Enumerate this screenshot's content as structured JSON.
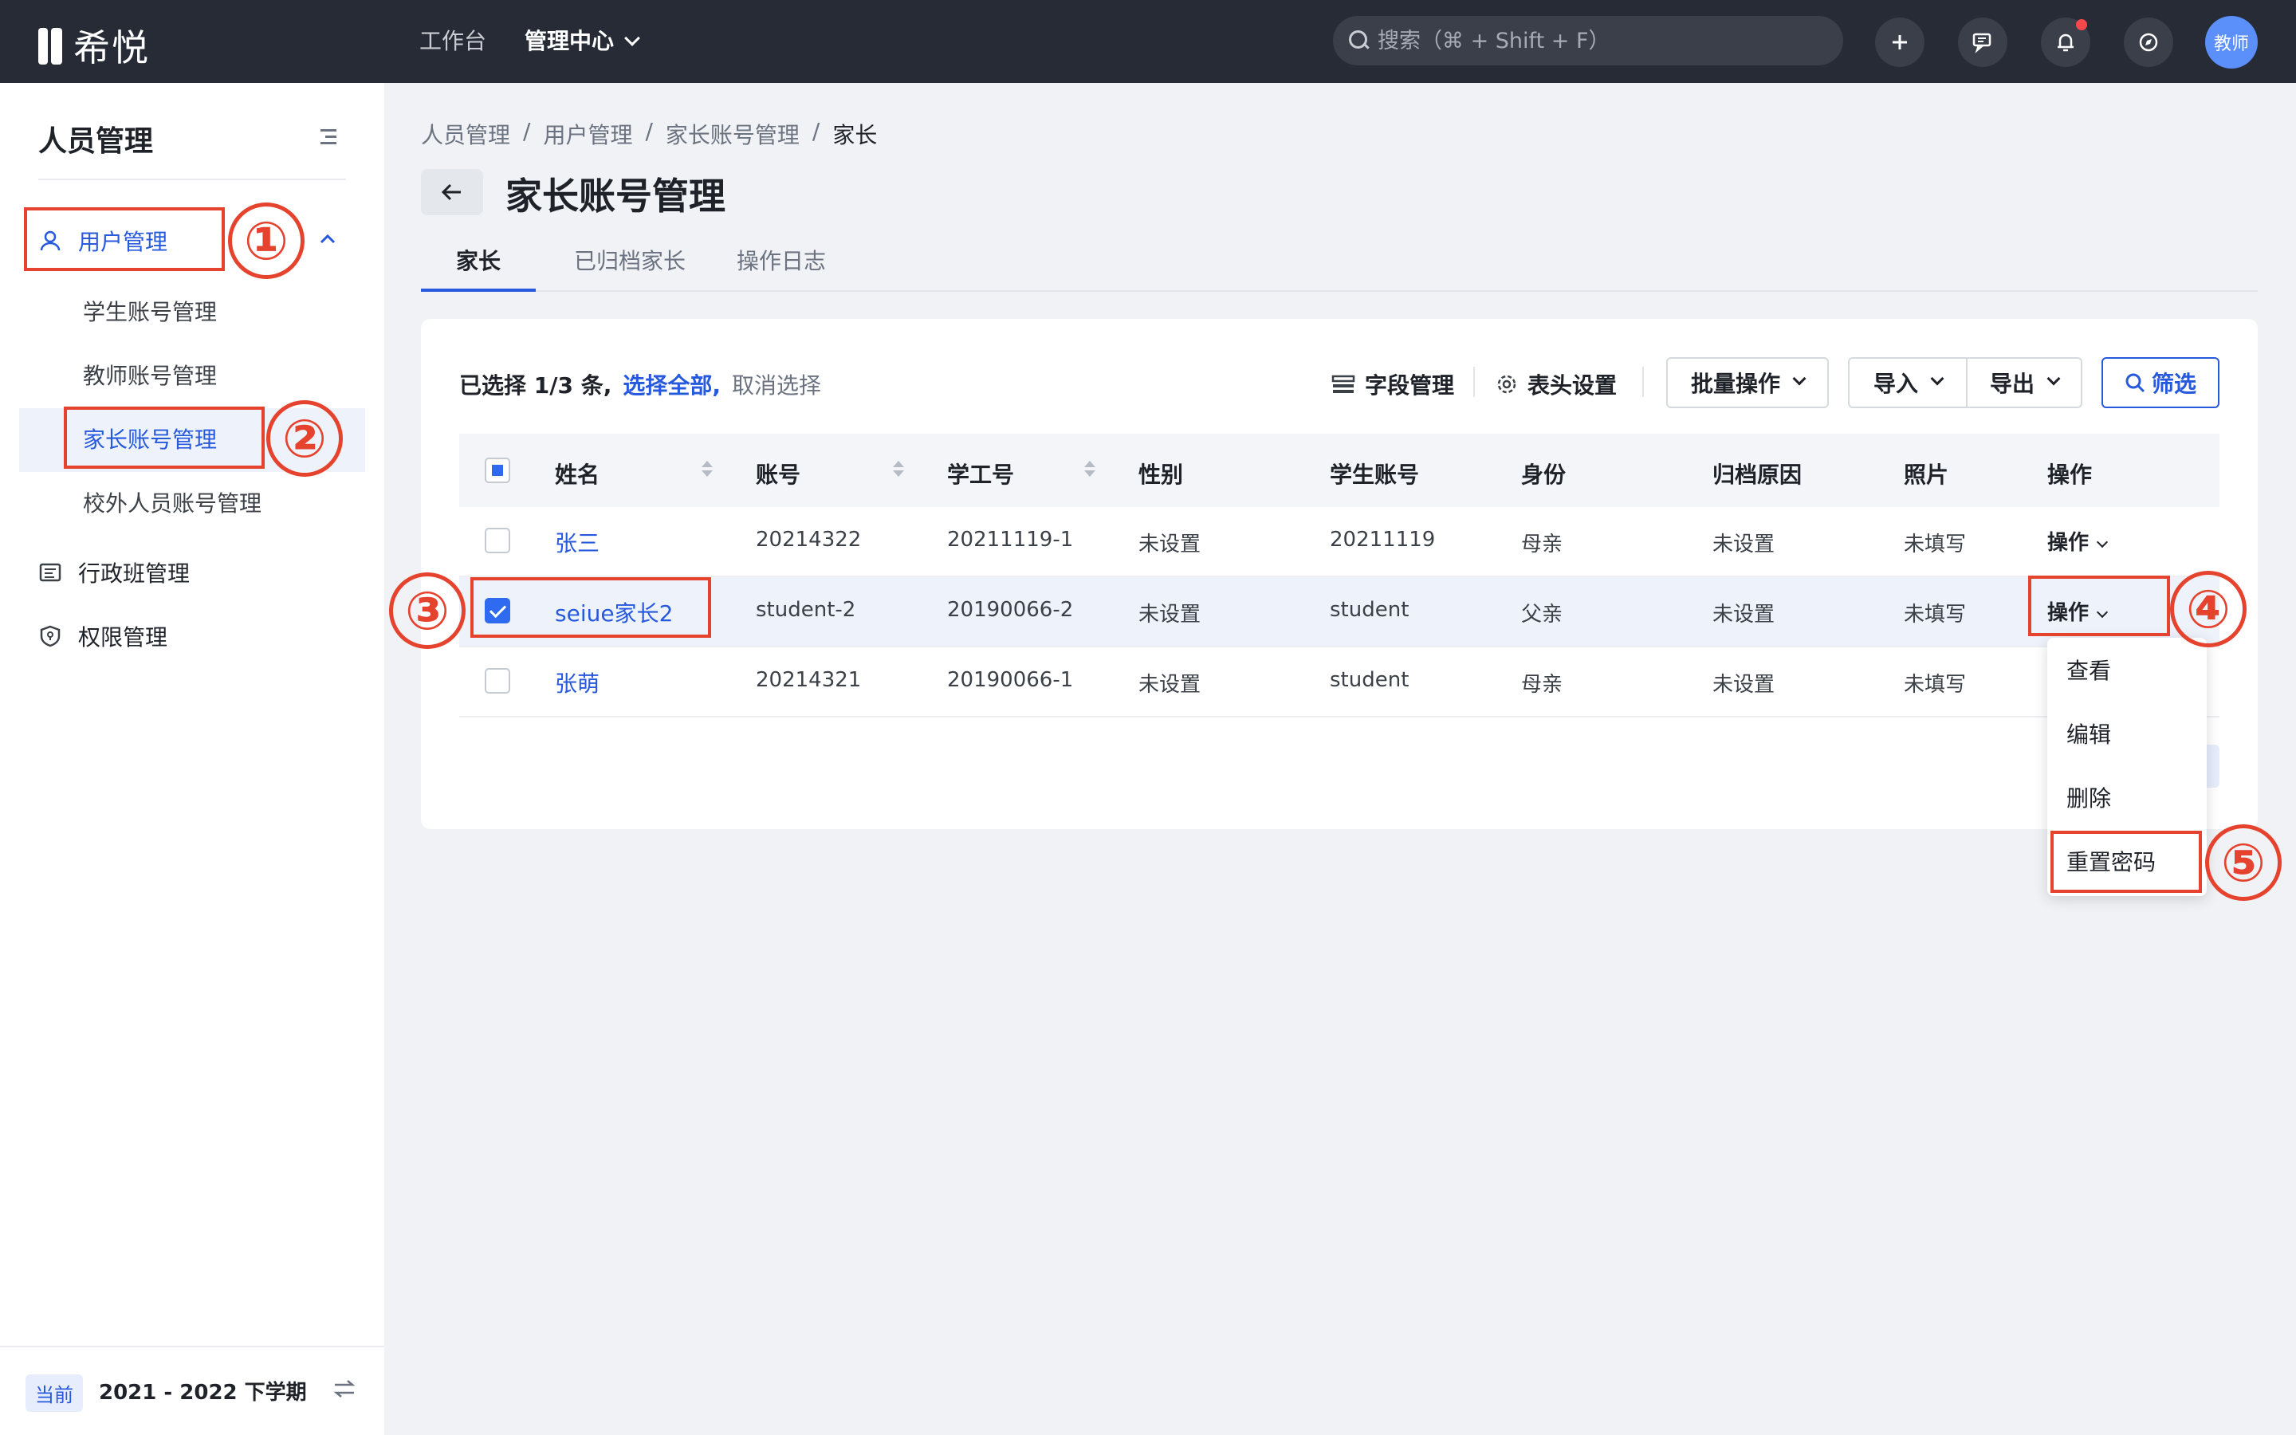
{
  "app": {
    "logo_text": "希悦"
  },
  "topnav": {
    "workbench": "工作台",
    "admin_center": "管理中心"
  },
  "search": {
    "placeholder": "搜索（⌘ + Shift + F）"
  },
  "topbar_icons": [
    "plus-icon",
    "chat-icon",
    "bell-icon",
    "compass-icon"
  ],
  "user": {
    "avatar_label": "教师"
  },
  "sidebar": {
    "title": "人员管理",
    "user_mgmt": "用户管理",
    "sub_items": [
      "学生账号管理",
      "教师账号管理",
      "家长账号管理",
      "校外人员账号管理"
    ],
    "admin_class": "行政班管理",
    "permission": "权限管理",
    "term_badge": "当前",
    "term_text": "2021 - 2022 下学期"
  },
  "breadcrumb": [
    "人员管理",
    "用户管理",
    "家长账号管理",
    "家长"
  ],
  "breadcrumb_sep": "/",
  "page_title": "家长账号管理",
  "tabs": [
    "家长",
    "已归档家长",
    "操作日志"
  ],
  "selection": {
    "selected": "已选择 1/3 条,",
    "select_all": "选择全部,",
    "cancel": "取消选择"
  },
  "toolbar": {
    "field_mgmt": "字段管理",
    "header_settings": "表头设置",
    "batch": "批量操作",
    "import": "导入",
    "export": "导出",
    "filter": "筛选"
  },
  "table": {
    "columns": [
      "姓名",
      "账号",
      "学工号",
      "性别",
      "学生账号",
      "身份",
      "归档原因",
      "照片",
      "操作"
    ],
    "rows": [
      {
        "name": "张三",
        "account": "20214322",
        "work_id": "20211119-1",
        "gender": "未设置",
        "student_account": "20211119",
        "identity": "母亲",
        "archive_reason": "未设置",
        "photo": "未填写",
        "op": "操作",
        "checked": false
      },
      {
        "name": "seiue家长2",
        "account": "student-2",
        "work_id": "20190066-2",
        "gender": "未设置",
        "student_account": "student",
        "identity": "父亲",
        "archive_reason": "未设置",
        "photo": "未填写",
        "op": "操作",
        "checked": true
      },
      {
        "name": "张萌",
        "account": "20214321",
        "work_id": "20190066-1",
        "gender": "未设置",
        "student_account": "student",
        "identity": "母亲",
        "archive_reason": "未设置",
        "photo": "未填写",
        "op": "",
        "checked": false
      }
    ]
  },
  "dropdown": [
    "查看",
    "编辑",
    "删除",
    "重置密码"
  ],
  "annotations": [
    "①",
    "②",
    "③",
    "④",
    "⑤"
  ],
  "colors": {
    "accent": "#2759dd",
    "topbar": "#262b36",
    "annotation": "#e5432e"
  }
}
